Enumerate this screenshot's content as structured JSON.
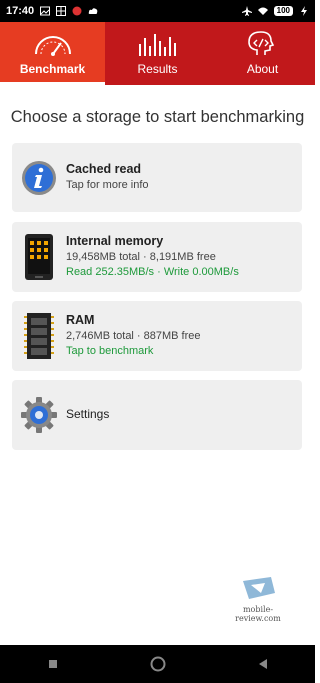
{
  "status_bar": {
    "time": "17:40",
    "battery": "100"
  },
  "tabs": [
    {
      "label": "Benchmark",
      "icon": "speedometer-icon",
      "active": true
    },
    {
      "label": "Results",
      "icon": "bars-icon",
      "active": false
    },
    {
      "label": "About",
      "icon": "head-code-icon",
      "active": false
    }
  ],
  "heading": "Choose a storage to start benchmarking",
  "cards": {
    "cached": {
      "title": "Cached read",
      "line1": "Tap for more info"
    },
    "internal": {
      "title": "Internal memory",
      "line1": "19,458MB total · 8,191MB free",
      "line2": "Read 252.35MB/s · Write 0.00MB/s"
    },
    "ram": {
      "title": "RAM",
      "line1": "2,746MB total · 887MB free",
      "line2": "Tap to benchmark"
    },
    "settings": {
      "title": "Settings"
    }
  },
  "watermark": "mobile-review.com",
  "colors": {
    "tab_bar": "#c1181b",
    "tab_active": "#e63c22",
    "green_text": "#1e9a3b",
    "card_bg": "#efefef"
  }
}
